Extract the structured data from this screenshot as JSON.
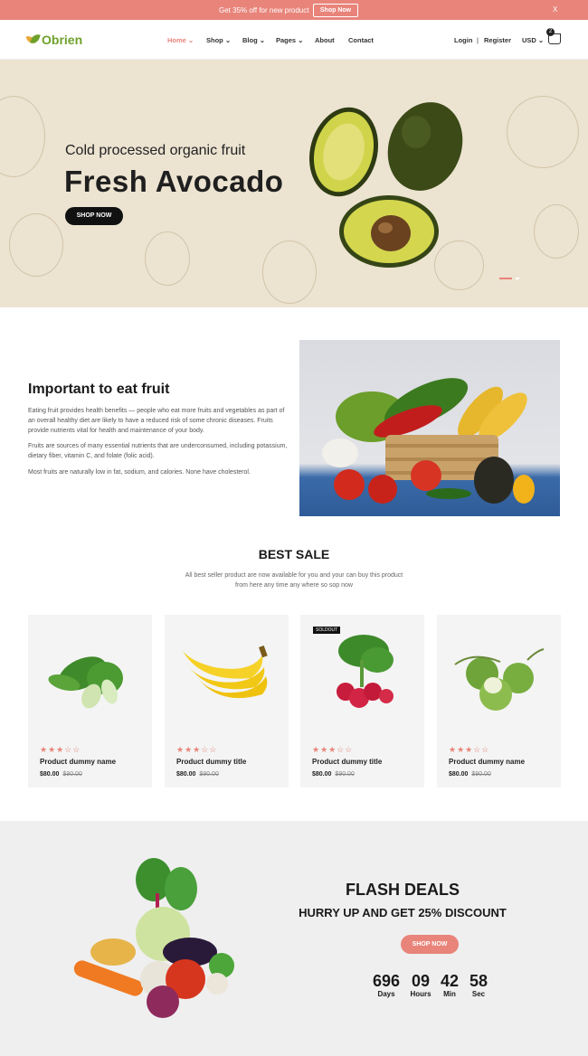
{
  "topbar": {
    "message": "Get 35% off for new product",
    "button": "Shop Now",
    "close": "X"
  },
  "header": {
    "brand": "Obrien",
    "nav": [
      {
        "label": "Home ⌄",
        "active": true
      },
      {
        "label": "Shop ⌄",
        "active": false
      },
      {
        "label": "Blog ⌄",
        "active": false
      },
      {
        "label": "Pages ⌄",
        "active": false
      },
      {
        "label": "About",
        "active": false
      },
      {
        "label": "Contact",
        "active": false
      }
    ],
    "login": "Login",
    "separator": "|",
    "register": "Register",
    "currency": "USD ⌄",
    "cart_count": "2"
  },
  "hero": {
    "subtitle": "Cold processed organic fruit",
    "title": "Fresh Avocado",
    "button": "SHOP NOW"
  },
  "about": {
    "title": "Important to eat fruit",
    "paragraphs": [
      "Eating fruit provides health benefits — people who eat more fruits and vegetables as part of an overall healthy diet are likely to have a reduced risk of some chronic diseases. Fruits provide nutrients vital for health and maintenance of your body.",
      "Fruits are sources of many essential nutrients that are underconsumed, including potassium, dietary fiber, vitamin C, and folate (folic acid).",
      "Most fruits are naturally low in fat, sodium, and calories. None have cholesterol."
    ]
  },
  "best_sale": {
    "title": "BEST SALE",
    "subtitle": "All best seller product are now available for you and your can buy this product from here any time any where so sop now",
    "products": [
      {
        "name": "Product dummy name",
        "price": "$80.00",
        "old_price": "$90.00",
        "rating": "★★★☆☆",
        "badge": ""
      },
      {
        "name": "Product dummy title",
        "price": "$80.00",
        "old_price": "$90.00",
        "rating": "★★★☆☆",
        "badge": ""
      },
      {
        "name": "Product dummy title",
        "price": "$80.00",
        "old_price": "$90.00",
        "rating": "★★★☆☆",
        "badge": "SOLDOUT"
      },
      {
        "name": "Product dummy name",
        "price": "$80.00",
        "old_price": "$90.00",
        "rating": "★★★☆☆",
        "badge": ""
      }
    ]
  },
  "flash": {
    "title": "FLASH DEALS",
    "subtitle": "HURRY UP AND GET 25% DISCOUNT",
    "button": "SHOP NOW",
    "countdown": [
      {
        "value": "696",
        "label": "Days"
      },
      {
        "value": "09",
        "label": "Hours"
      },
      {
        "value": "42",
        "label": "Min"
      },
      {
        "value": "58",
        "label": "Sec"
      }
    ]
  },
  "colors": {
    "accent": "#e8847a",
    "brand_green": "#6ea12a",
    "hero_bg": "#ece3d1",
    "dark": "#111111"
  }
}
